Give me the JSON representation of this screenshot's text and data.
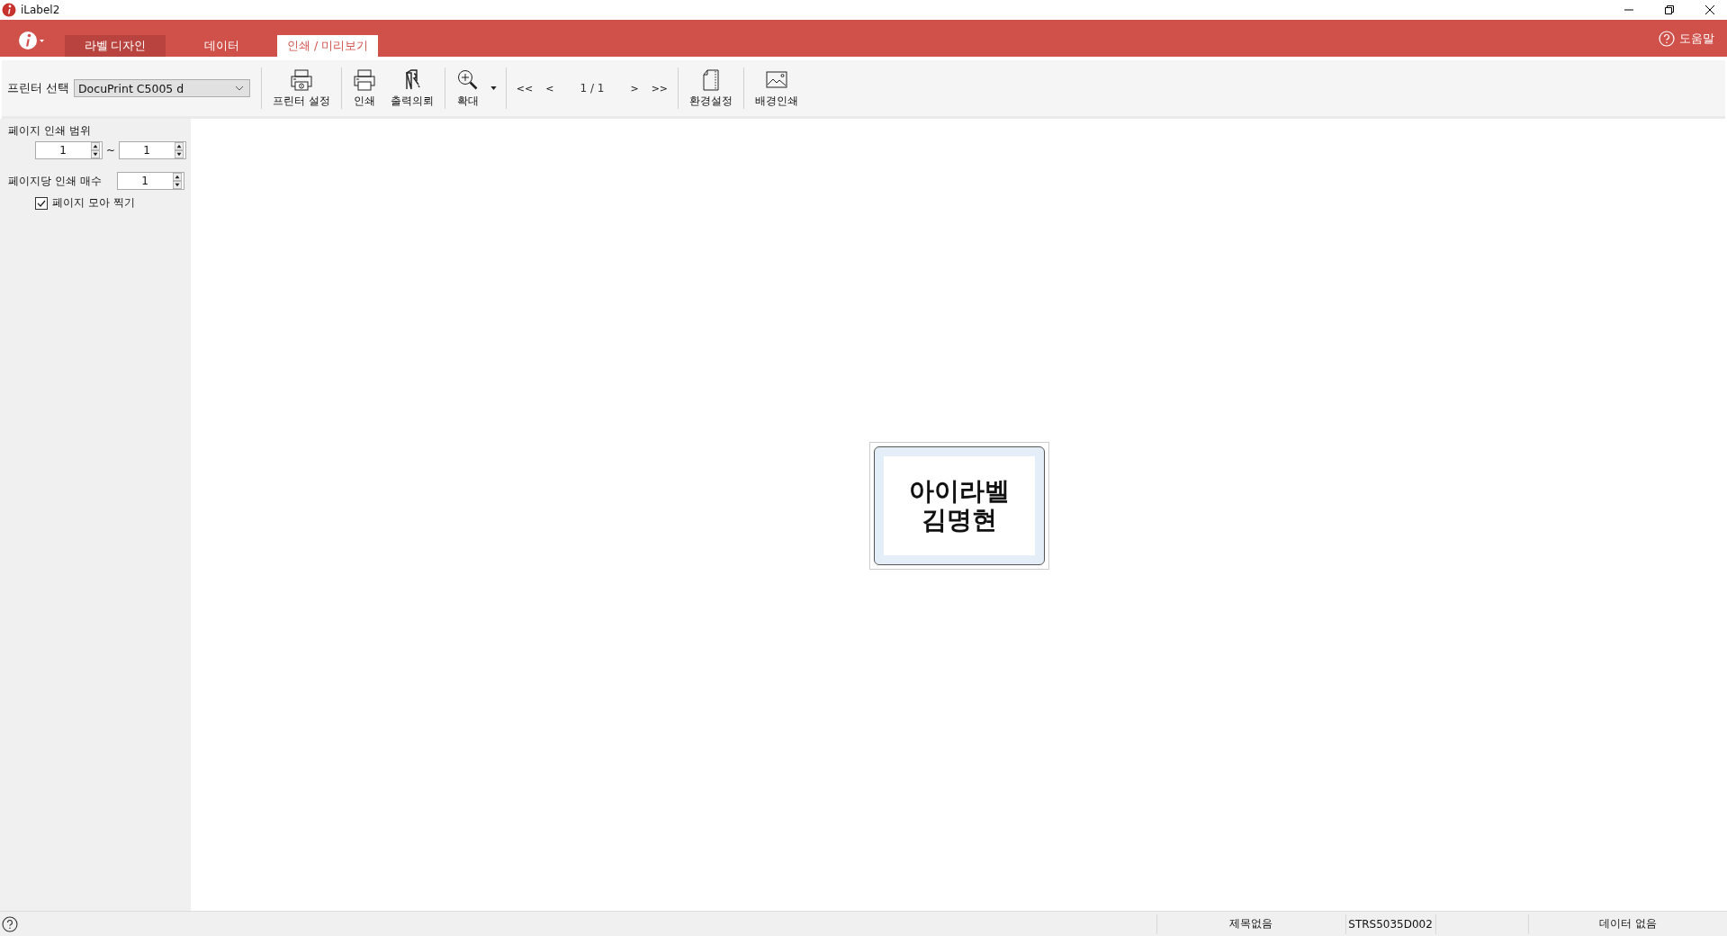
{
  "window": {
    "title": "iLabel2"
  },
  "tabs": [
    {
      "label": "라벨 디자인",
      "selected": false,
      "hover": true
    },
    {
      "label": "데이터",
      "selected": false,
      "hover": false
    },
    {
      "label": "인쇄 / 미리보기",
      "selected": true,
      "hover": false
    }
  ],
  "help": {
    "label": "도움말"
  },
  "toolbar": {
    "printer_label": "프린터 선택",
    "printer_value": "DocuPrint C5005 d",
    "items": [
      {
        "kind": "button",
        "label": "프린터 설정"
      },
      {
        "kind": "separator"
      },
      {
        "kind": "button",
        "label": "인쇄"
      },
      {
        "kind": "button",
        "label": "출력의뢰"
      },
      {
        "kind": "separator"
      },
      {
        "kind": "dropdown",
        "label": "확대"
      },
      {
        "kind": "separator"
      },
      {
        "kind": "nav",
        "label": "<<"
      },
      {
        "kind": "nav",
        "label": "<"
      },
      {
        "kind": "page",
        "label": "1 / 1"
      },
      {
        "kind": "nav",
        "label": ">"
      },
      {
        "kind": "nav",
        "label": ">>"
      },
      {
        "kind": "separator"
      },
      {
        "kind": "button",
        "label": "환경설정"
      },
      {
        "kind": "separator"
      },
      {
        "kind": "button",
        "label": "배경인쇄"
      }
    ]
  },
  "side_panel": {
    "range_label": "페이지 인쇄 범위",
    "range_from": "1",
    "range_sep": "~",
    "range_to": "1",
    "copies_label": "페이지당 인쇄 매수",
    "copies": "1",
    "collate": {
      "label": "페이지 모아 찍기",
      "checked": true
    }
  },
  "preview": {
    "label_lines": [
      "아이라벨",
      "김명현"
    ]
  },
  "status_bar": [
    "제목없음",
    "STRS5035D002",
    "데이터 없음"
  ]
}
